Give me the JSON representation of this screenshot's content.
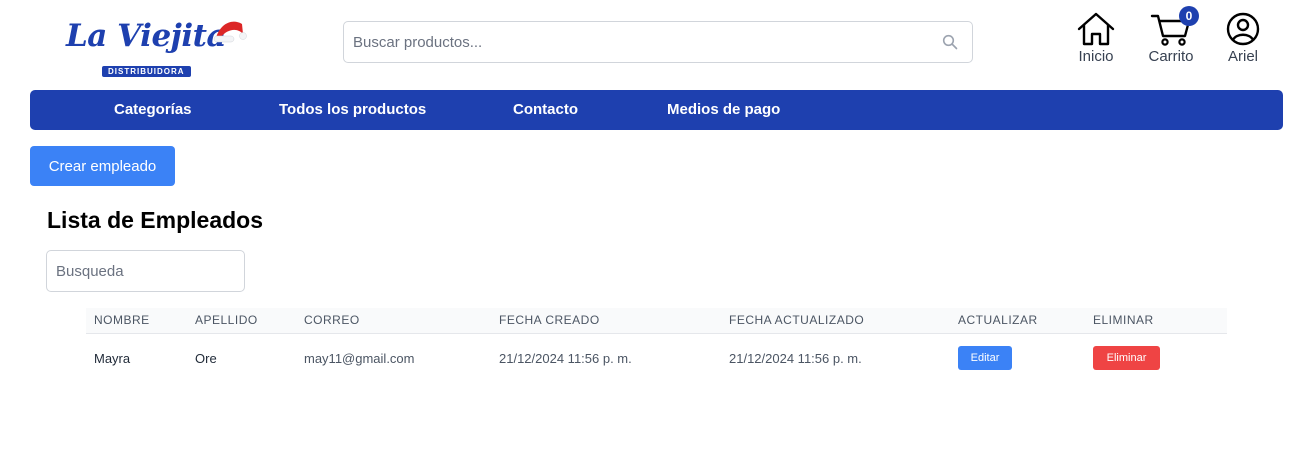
{
  "header": {
    "logo": {
      "text": "La Viejita",
      "subtitle": "DISTRIBUIDORA"
    },
    "search": {
      "placeholder": "Buscar productos...",
      "value": ""
    },
    "buttons": [
      {
        "label": "Inicio",
        "icon": "home-icon"
      },
      {
        "label": "Carrito",
        "icon": "cart-icon",
        "badge": "0"
      },
      {
        "label": "Ariel",
        "icon": "user-icon"
      }
    ]
  },
  "nav": {
    "items": [
      "Categorías",
      "Todos los productos",
      "Contacto",
      "Medios de pago"
    ]
  },
  "main": {
    "create_button": "Crear empleado",
    "title": "Lista de Empleados",
    "filter_placeholder": "Busqueda",
    "table": {
      "headers": [
        "NOMBRE",
        "APELLIDO",
        "CORREO",
        "FECHA CREADO",
        "FECHA ACTUALIZADO",
        "ACTUALIZAR",
        "ELIMINAR"
      ],
      "rows": [
        {
          "nombre": "Mayra",
          "apellido": "Ore",
          "correo": "may11@gmail.com",
          "fecha_creado": "21/12/2024 11:56 p. m.",
          "fecha_actualizado": "21/12/2024 11:56 p. m.",
          "edit_label": "Editar",
          "delete_label": "Eliminar"
        }
      ]
    }
  },
  "colors": {
    "brand": "#1e40af",
    "primary_button": "#3b82f6",
    "danger_button": "#ef4444"
  }
}
